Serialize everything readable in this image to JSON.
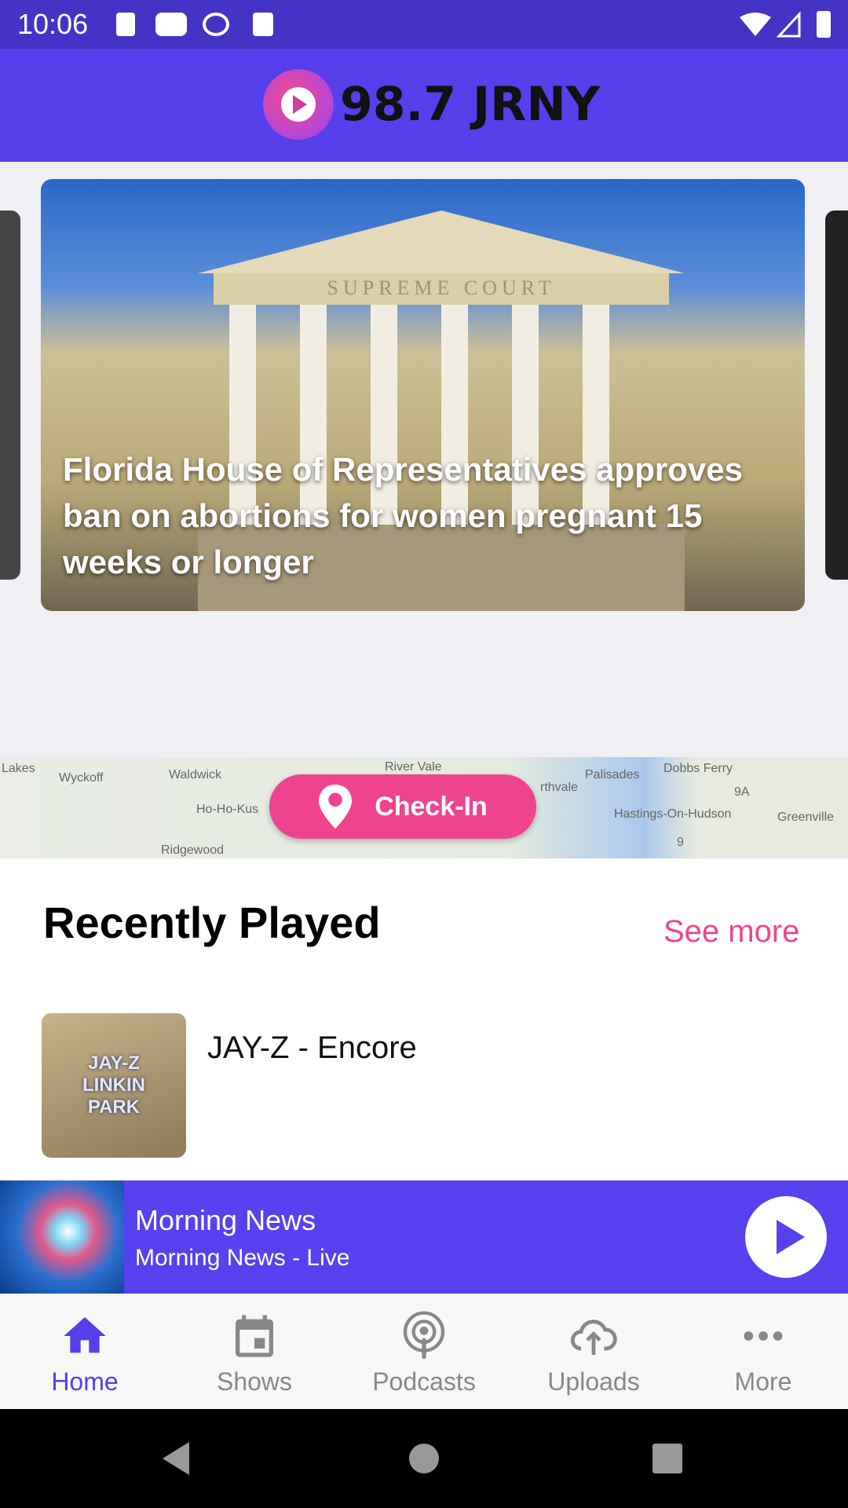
{
  "status_bar": {
    "time": "10:06",
    "icons": [
      "a-icon",
      "youtube-icon",
      "q-icon",
      "sd-card-icon",
      "wifi-icon",
      "signal-icon",
      "battery-icon"
    ]
  },
  "app_bar": {
    "logo_text": "98.7 JRNY"
  },
  "carousel": {
    "items": [
      {
        "headline": "Florida House of Representatives approves ban on abortions for women pregnant 15 weeks or longer",
        "image_label": "SUPREME COURT"
      }
    ]
  },
  "map": {
    "labels": [
      "Lakes",
      "Wyckoff",
      "Waldwick",
      "River Vale",
      "Palisades",
      "Dobbs Ferry",
      "Ho-Ho-Kus",
      "rthvale",
      "Hastings-On-Hudson",
      "Greenville",
      "Ridgewood",
      "9A",
      "9"
    ]
  },
  "checkin": {
    "label": "Check-In"
  },
  "recently_played": {
    "title": "Recently Played",
    "see_more": "See more",
    "items": [
      {
        "title": "JAY-Z - Encore",
        "art_text": "JAY-Z LINKIN PARK"
      }
    ]
  },
  "player": {
    "title": "Morning News",
    "subtitle": "Morning News - Live"
  },
  "nav": {
    "items": [
      {
        "label": "Home",
        "icon": "home-icon",
        "active": true
      },
      {
        "label": "Shows",
        "icon": "calendar-icon"
      },
      {
        "label": "Podcasts",
        "icon": "podcast-icon"
      },
      {
        "label": "Uploads",
        "icon": "cloud-upload-icon"
      },
      {
        "label": "More",
        "icon": "more-icon"
      }
    ]
  },
  "colors": {
    "primary": "#5540ec",
    "accent": "#ee4490",
    "status_bar": "#4433c4"
  }
}
